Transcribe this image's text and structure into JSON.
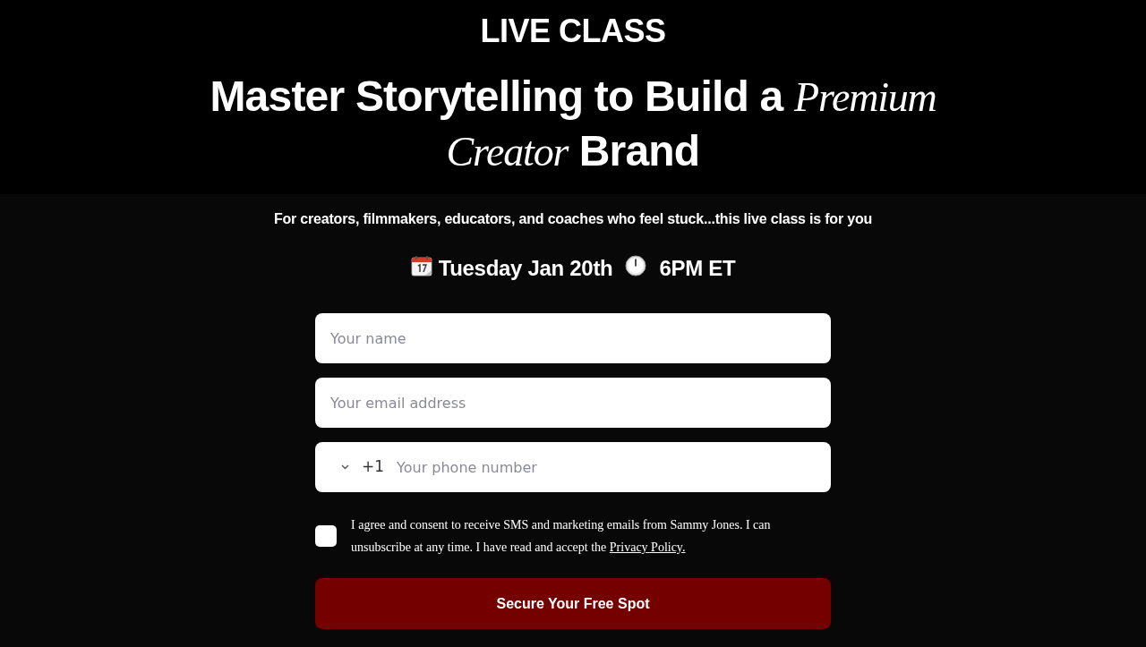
{
  "header": {
    "eyebrow": "LIVE CLASS",
    "headline": "Master Storytelling to Build a *Premium Creator* Brand"
  },
  "subtitle": "For creators, filmmakers, educators, and coaches who feel stuck...this live class is for you",
  "schedule": {
    "date": "Tuesday Jan 20th",
    "time": "6PM ET"
  },
  "form": {
    "fields": [
      {
        "kind": "text",
        "placeholder": "Your name"
      },
      {
        "kind": "text",
        "placeholder": "Your email address"
      },
      {
        "kind": "phone",
        "dial_code": "+1",
        "placeholder": "Your phone number"
      }
    ],
    "consent": {
      "checked": false,
      "text": "I agree and consent to receive SMS and marketing emails from Sammy Jones. I can unsubscribe at any time. I have read and accept the",
      "link": "Privacy Policy."
    },
    "submit": "Secure Your Free Spot"
  }
}
